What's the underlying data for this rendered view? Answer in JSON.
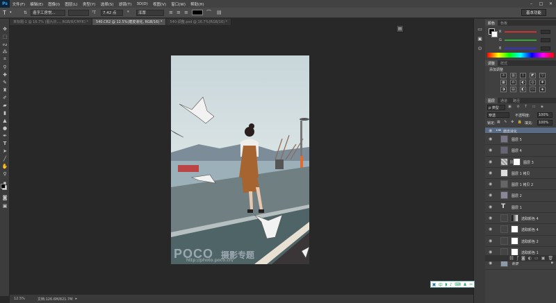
{
  "app": {
    "logo": "Ps"
  },
  "menu": [
    "文件(F)",
    "编辑(E)",
    "图像(I)",
    "图层(L)",
    "类型(Y)",
    "选择(S)",
    "滤镜(T)",
    "3D(D)",
    "视图(V)",
    "窗口(W)",
    "帮助(H)"
  ],
  "options": {
    "tool_icon": "T",
    "font_family": "造字工房悦...",
    "font_size": "7.42 点",
    "antialias_label": "ª",
    "antialias": "浑厚",
    "workspace": "基本功能"
  },
  "tabs": [
    {
      "label": "未标题-1 @ 16.7% (图九许..., RGB/8/CMYK) *",
      "active": false
    },
    {
      "label": "540.CR2 @ 12.5%(磨皮液化, RGB/16) *",
      "active": true
    },
    {
      "label": "540-调整.psd @ 16.7%(RGB/16) *",
      "active": false
    }
  ],
  "status": {
    "zoom": "12.5%",
    "doc": "文档:126.6M/821.7M"
  },
  "panels": {
    "color_tabs": [
      "颜色",
      "色板"
    ],
    "swatch_r": "R",
    "swatch_g": "G",
    "swatch_b": "B",
    "adjust_tabs": [
      "调整",
      "样式"
    ],
    "adjust_title": "添加调整",
    "layers_tabs": [
      "图层",
      "通道",
      "路径"
    ],
    "layer_kind": "ρ 类型",
    "blend_mode": "穿透",
    "opacity_label": "不透明度:",
    "opacity_value": "100%",
    "lock_label": "锁定:",
    "fill_label": "填充:",
    "fill_value": "100%"
  },
  "layers": [
    {
      "name": "磨皮液化",
      "type": "group"
    },
    {
      "name": "图层 5",
      "type": "pixel",
      "thumb": "#778"
    },
    {
      "name": "图层 4",
      "type": "pixel",
      "thumb": "#667"
    },
    {
      "name": "图层 3",
      "type": "masked",
      "thumb": "#999"
    },
    {
      "name": "图层 1 拷贝",
      "type": "pixel",
      "thumb": "#ddd"
    },
    {
      "name": "图层 1 拷贝 2",
      "type": "pixel",
      "thumb": "#666"
    },
    {
      "name": "图层 2",
      "type": "pixel",
      "thumb": "#889"
    },
    {
      "name": "图层 1",
      "type": "text",
      "thumb": "#555"
    },
    {
      "name": "选取颜色 4",
      "type": "adjust",
      "thumb": "#444"
    },
    {
      "name": "选取颜色 4",
      "type": "adjust",
      "thumb": "#444"
    },
    {
      "name": "选取颜色 2",
      "type": "adjust",
      "thumb": "#444"
    },
    {
      "name": "选取颜色 1",
      "type": "adjust",
      "thumb": "#444"
    },
    {
      "name": "背景",
      "type": "background",
      "thumb": "#8a9aa8"
    }
  ],
  "watermark": {
    "brand": "POCO",
    "tagline": "摄影专题",
    "url": "http://photo.poco.cn/"
  },
  "ime": {
    "mode": "中"
  },
  "colors": {
    "accent": "#31a8ff",
    "group_row": "#5a6b84"
  }
}
